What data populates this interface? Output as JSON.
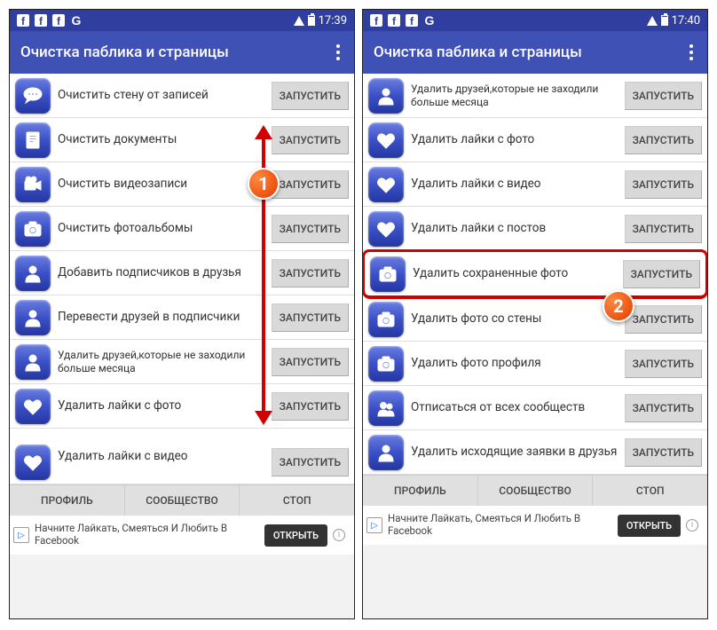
{
  "status": {
    "time_left": "17:39",
    "time_right": "17:40"
  },
  "app": {
    "title": "Очистка паблика и страницы"
  },
  "actions": {
    "run": "ЗАПУСТИТЬ"
  },
  "tabs": {
    "profile": "ПРОФИЛЬ",
    "community": "СООБЩЕСТВО",
    "stop": "СТОП"
  },
  "ad": {
    "text": "Начните Лайкать, Смеяться И Любить В Facebook",
    "open": "ОТКРЫТЬ",
    "marker": "▷"
  },
  "left_list": [
    {
      "icon": "chat",
      "label": "Очистить стену от записей"
    },
    {
      "icon": "doc",
      "label": "Очистить документы"
    },
    {
      "icon": "video",
      "label": "Очистить видеозаписи"
    },
    {
      "icon": "camera",
      "label": "Очистить фотоальбомы"
    },
    {
      "icon": "person",
      "label": "Добавить подписчиков в друзья"
    },
    {
      "icon": "person",
      "label": "Перевести друзей в подписчики"
    },
    {
      "icon": "person",
      "label": "Удалить друзей,которые не заходили больше месяца",
      "small": true
    },
    {
      "icon": "heart",
      "label": "Удалить лайки с фото"
    },
    {
      "icon": "heart",
      "label": "Удалить лайки с видео",
      "cut": true
    }
  ],
  "right_list": [
    {
      "icon": "person",
      "label": "Удалить друзей,которые не заходили больше месяца",
      "small": true
    },
    {
      "icon": "heart",
      "label": "Удалить лайки с фото"
    },
    {
      "icon": "heart",
      "label": "Удалить лайки с видео"
    },
    {
      "icon": "heart",
      "label": "Удалить лайки с постов"
    },
    {
      "icon": "camera",
      "label": "Удалить сохраненные фото",
      "highlight": true
    },
    {
      "icon": "camera",
      "label": "Удалить фото со стены"
    },
    {
      "icon": "camera",
      "label": "Удалить фото профиля"
    },
    {
      "icon": "people",
      "label": "Отписаться от всех сообществ"
    },
    {
      "icon": "person",
      "label": "Удалить исходящие заявки в друзья"
    }
  ],
  "badges": {
    "one": "1",
    "two": "2"
  }
}
